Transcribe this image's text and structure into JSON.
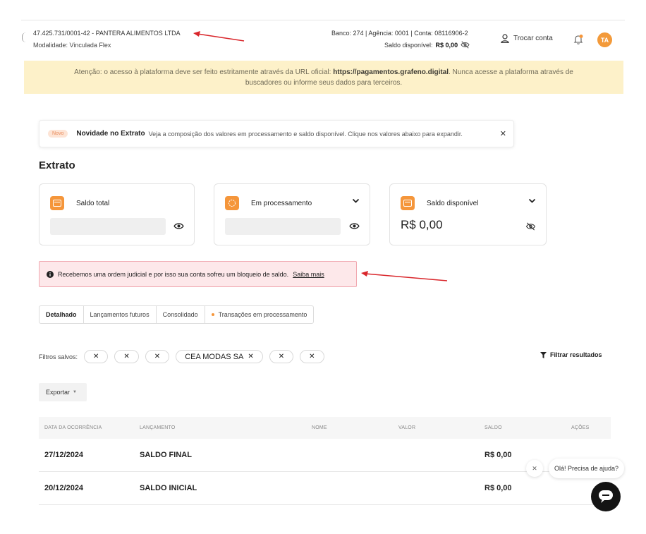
{
  "header": {
    "company": "47.425.731/0001-42 - PANTERA ALIMENTOS LTDA",
    "modality": "Modalidade: Vinculada Flex",
    "bank_info": "Banco: 274 | Agência: 0001 | Conta: 08116906-2",
    "balance_label": "Saldo disponível:",
    "balance_value": "R$ 0,00",
    "switch_account": "Trocar conta",
    "avatar_initials": "TA"
  },
  "warning": {
    "prefix": "Atenção: o acesso à plataforma deve ser feito estritamente através da URL oficial: ",
    "url": "https://pagamentos.grafeno.digital",
    "suffix": ". Nunca acesse a plataforma através de",
    "line2": "buscadores ou informe seus dados para terceiros."
  },
  "news": {
    "badge": "Novo",
    "title": "Novidade no Extrato",
    "text": "Veja a composição dos valores em processamento e saldo disponível. Clique nos valores abaixo para expandir."
  },
  "page_title": "Extrato",
  "cards": {
    "total": {
      "label": "Saldo total"
    },
    "processing": {
      "label": "Em processamento"
    },
    "available": {
      "label": "Saldo disponível",
      "value": "R$ 0,00"
    }
  },
  "alert": {
    "text": "Recebemos uma ordem judicial e por isso sua conta sofreu um bloqueio de saldo.",
    "link": "Saiba mais"
  },
  "tabs": [
    {
      "label": "Detalhado"
    },
    {
      "label": "Lançamentos futuros"
    },
    {
      "label": "Consolidado"
    },
    {
      "label": "Transações em processamento"
    }
  ],
  "filters": {
    "label": "Filtros salvos:",
    "chip_named": "CEA MODAS SA",
    "filter_results": "Filtrar resultados"
  },
  "export_label": "Exportar",
  "table": {
    "headers": {
      "date": "DATA DA OCORRÊNCIA",
      "entry": "LANÇAMENTO",
      "name": "NOME",
      "value": "VALOR",
      "balance": "SALDO",
      "actions": "AÇÕES"
    },
    "rows": [
      {
        "date": "27/12/2024",
        "entry": "SALDO FINAL",
        "balance": "R$ 0,00"
      },
      {
        "date": "20/12/2024",
        "entry": "SALDO INICIAL",
        "balance": "R$ 0,00"
      }
    ]
  },
  "help": {
    "bubble": "Olá! Precisa de ajuda?"
  },
  "colors": {
    "accent": "#f5963b",
    "warning_bg": "#fdf1c9",
    "alert_bg": "#fde8ea",
    "alert_border": "#f1a9b1",
    "annotation_arrow": "#d9262b"
  }
}
